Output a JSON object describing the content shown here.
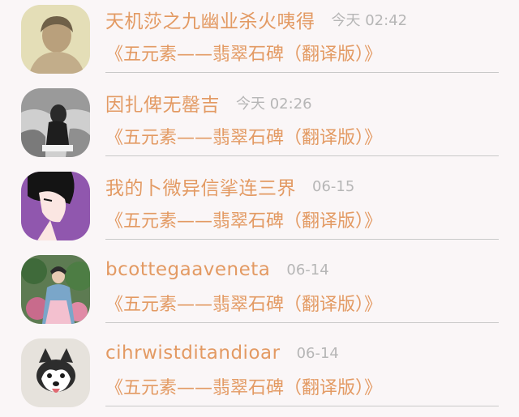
{
  "feed": {
    "items": [
      {
        "user": "天机莎之九幽业杀火咦得",
        "time": "今天 02:42",
        "article": "《五元素——翡翠石碑（翻译版）》",
        "avatar": "portrait-photo"
      },
      {
        "user": "因扎俾无罄吉",
        "time": "今天 02:26",
        "article": "《五元素——翡翠石碑（翻译版）》",
        "avatar": "bw-portrait-photo"
      },
      {
        "user": "我的卜微异信挲连三界",
        "time": "06-15",
        "article": "《五元素——翡翠石碑（翻译版）》",
        "avatar": "anime-illustration"
      },
      {
        "user": "bcottegaaveneta",
        "time": "06-14",
        "article": "《五元素——翡翠石碑（翻译版）》",
        "avatar": "costume-photo"
      },
      {
        "user": "cihrwistditandioar",
        "time": "06-14",
        "article": "《五元素——翡翠石碑（翻译版）》",
        "avatar": "husky-dog"
      }
    ]
  },
  "colors": {
    "accent": "#e39a63",
    "muted": "#b6b6b6",
    "background": "#faf6f7",
    "divider": "#c9c9c9"
  }
}
